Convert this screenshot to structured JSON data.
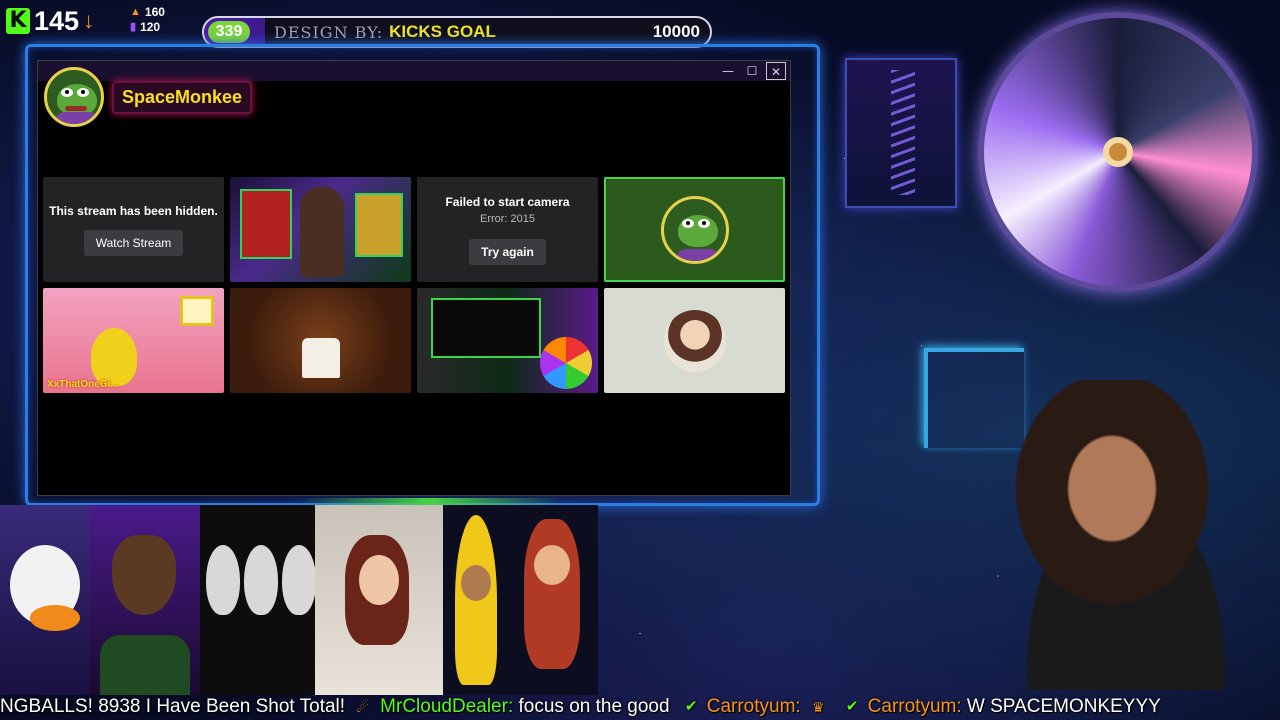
{
  "kick_counter": {
    "value": "145",
    "stat_a": "160",
    "stat_b": "120"
  },
  "goal": {
    "current": "339",
    "watermark": "DESIGN BY:",
    "name": "KICKS GOAL",
    "target": "10000",
    "progress_fraction": 0.0339
  },
  "window": {
    "controls": {
      "minimize": "—",
      "maximize": "☐",
      "close": "✕"
    },
    "user": {
      "name": "SpaceMonkee"
    },
    "tiles": {
      "hidden_stream": {
        "text": "This stream has been hidden.",
        "button": "Watch Stream"
      },
      "camera_error": {
        "title": "Failed to start camera",
        "error": "Error: 2015",
        "button": "Try again"
      },
      "banana_label": "XxThatOneGi..."
    }
  },
  "ticker": {
    "segments": [
      {
        "user": "",
        "message": "NGBALLS! 8938 I Have Been Shot Total!"
      },
      {
        "user": "MrCloudDealer:",
        "message": "focus on the good"
      },
      {
        "user": "Carrotyum:",
        "message": ""
      },
      {
        "user": "Carrotyum:",
        "message": "W SPACEMONKEYYY"
      }
    ]
  },
  "colors": {
    "kick_green": "#53fc18",
    "goal_yellow": "#f3e61e",
    "accent_purple": "#4a1fa8",
    "frame_blue": "#2b7fe0"
  }
}
